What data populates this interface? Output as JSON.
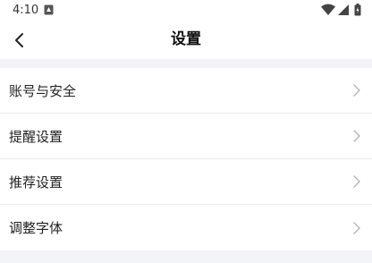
{
  "status_bar": {
    "time": "4:10",
    "icons": [
      "notification-icon",
      "wifi-icon",
      "signal-icon",
      "battery-icon"
    ]
  },
  "header": {
    "back_icon": "chevron-left-icon",
    "title": "设置"
  },
  "settings": {
    "items": [
      {
        "label": "账号与安全",
        "icon": "chevron-right-icon"
      },
      {
        "label": "提醒设置",
        "icon": "chevron-right-icon"
      },
      {
        "label": "推荐设置",
        "icon": "chevron-right-icon"
      },
      {
        "label": "调整字体",
        "icon": "chevron-right-icon"
      }
    ]
  },
  "colors": {
    "background": "#f3f4f8",
    "surface": "#ffffff",
    "text": "#222222",
    "chevron": "#b5b5b5"
  }
}
